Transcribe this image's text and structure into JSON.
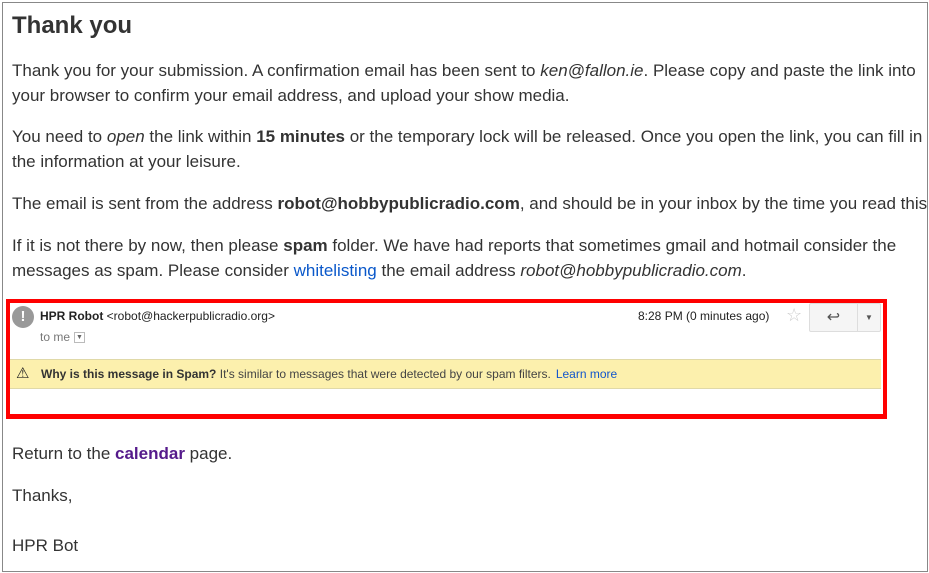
{
  "title": "Thank you",
  "para1": {
    "a": "Thank you for your submission. A confirmation email has been sent to ",
    "email": "ken@fallon.ie",
    "b": ". Please copy and paste the link into",
    "c": "your browser to confirm your email address, and upload your show media."
  },
  "para2": {
    "a": "You need to ",
    "open": "open",
    "b": " the link within ",
    "minutes": "15 minutes",
    "c": " or the temporary lock will be released. Once you open the link, you can fill in",
    "d": "the information at your leisure."
  },
  "para3": {
    "a": "The email is sent from the address ",
    "address": "robot@hobbypublicradio.com",
    "b": ", and should be in your inbox by the time you read this."
  },
  "para4": {
    "a": "If it is not there by now, then please ",
    "spam": "spam",
    "b": " folder. We have had reports that sometimes gmail and hotmail consider the",
    "c": "messages as spam. Please consider ",
    "link": "whitelisting",
    "d": " the email address ",
    "address": "robot@hobbypublicradio.com",
    "e": "."
  },
  "email_preview": {
    "sender_name": "HPR Robot",
    "sender_email": "<robot@hackerpublicradio.org>",
    "to": "to me",
    "time": "8:28 PM (0 minutes ago)",
    "spam_heading": "Why is this message in Spam?",
    "spam_text": "It's similar to messages that were detected by our spam filters.",
    "learn_more": "Learn more",
    "highlight_color": "#ff0000",
    "banner_color": "#fcf0ad"
  },
  "return": {
    "a": "Return to the ",
    "link": "calendar",
    "b": " page."
  },
  "thanks": "Thanks,",
  "signature": "HPR Bot"
}
